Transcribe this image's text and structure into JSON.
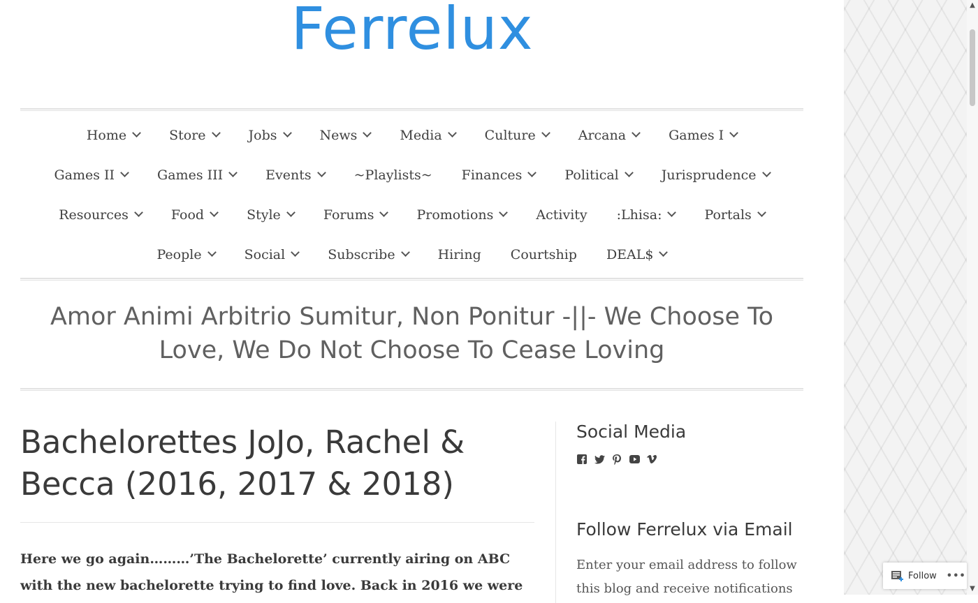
{
  "site": {
    "title": "Ferrelux",
    "tagline": "Amor Animi Arbitrio Sumitur, Non Ponitur -||- We Choose To Love, We Do Not Choose To Cease Loving"
  },
  "nav": {
    "rows": [
      [
        {
          "label": "Home",
          "dropdown": true
        },
        {
          "label": "Store",
          "dropdown": true
        },
        {
          "label": "Jobs",
          "dropdown": true
        },
        {
          "label": "News",
          "dropdown": true
        },
        {
          "label": "Media",
          "dropdown": true
        },
        {
          "label": "Culture",
          "dropdown": true
        },
        {
          "label": "Arcana",
          "dropdown": true
        },
        {
          "label": "Games I",
          "dropdown": true
        }
      ],
      [
        {
          "label": "Games II",
          "dropdown": true
        },
        {
          "label": "Games III",
          "dropdown": true
        },
        {
          "label": "Events",
          "dropdown": true
        },
        {
          "label": "~Playlists~",
          "dropdown": false
        },
        {
          "label": "Finances",
          "dropdown": true
        },
        {
          "label": "Political",
          "dropdown": true
        },
        {
          "label": "Jurisprudence",
          "dropdown": true
        }
      ],
      [
        {
          "label": "Resources",
          "dropdown": true
        },
        {
          "label": "Food",
          "dropdown": true
        },
        {
          "label": "Style",
          "dropdown": true
        },
        {
          "label": "Forums",
          "dropdown": true
        },
        {
          "label": "Promotions",
          "dropdown": true
        },
        {
          "label": "Activity",
          "dropdown": false
        },
        {
          "label": ":Lhisa:",
          "dropdown": true
        },
        {
          "label": "Portals",
          "dropdown": true
        }
      ],
      [
        {
          "label": "People",
          "dropdown": true
        },
        {
          "label": "Social",
          "dropdown": true
        },
        {
          "label": "Subscribe",
          "dropdown": true
        },
        {
          "label": "Hiring",
          "dropdown": false
        },
        {
          "label": "Courtship",
          "dropdown": false
        },
        {
          "label": "DEAL$",
          "dropdown": true
        }
      ]
    ]
  },
  "post": {
    "title": "Bachelorettes JoJo, Rachel & Becca (2016, 2017 & 2018)",
    "excerpt": "Here we go again………’The Bachelorette’ currently airing on ABC with the new bachelorette trying to find love. Back in 2016 we were"
  },
  "sidebar": {
    "social_title": "Social Media",
    "social_icons": [
      "facebook-icon",
      "twitter-icon",
      "pinterest-icon",
      "youtube-icon",
      "vimeo-icon"
    ],
    "follow_title": "Follow Ferrelux via Email",
    "follow_text": "Enter your email address to follow this blog and receive notifications"
  },
  "follow_bar": {
    "label": "Follow",
    "more": "•••"
  },
  "colors": {
    "title": "#2f8fe0",
    "text": "#3a3a3a"
  }
}
